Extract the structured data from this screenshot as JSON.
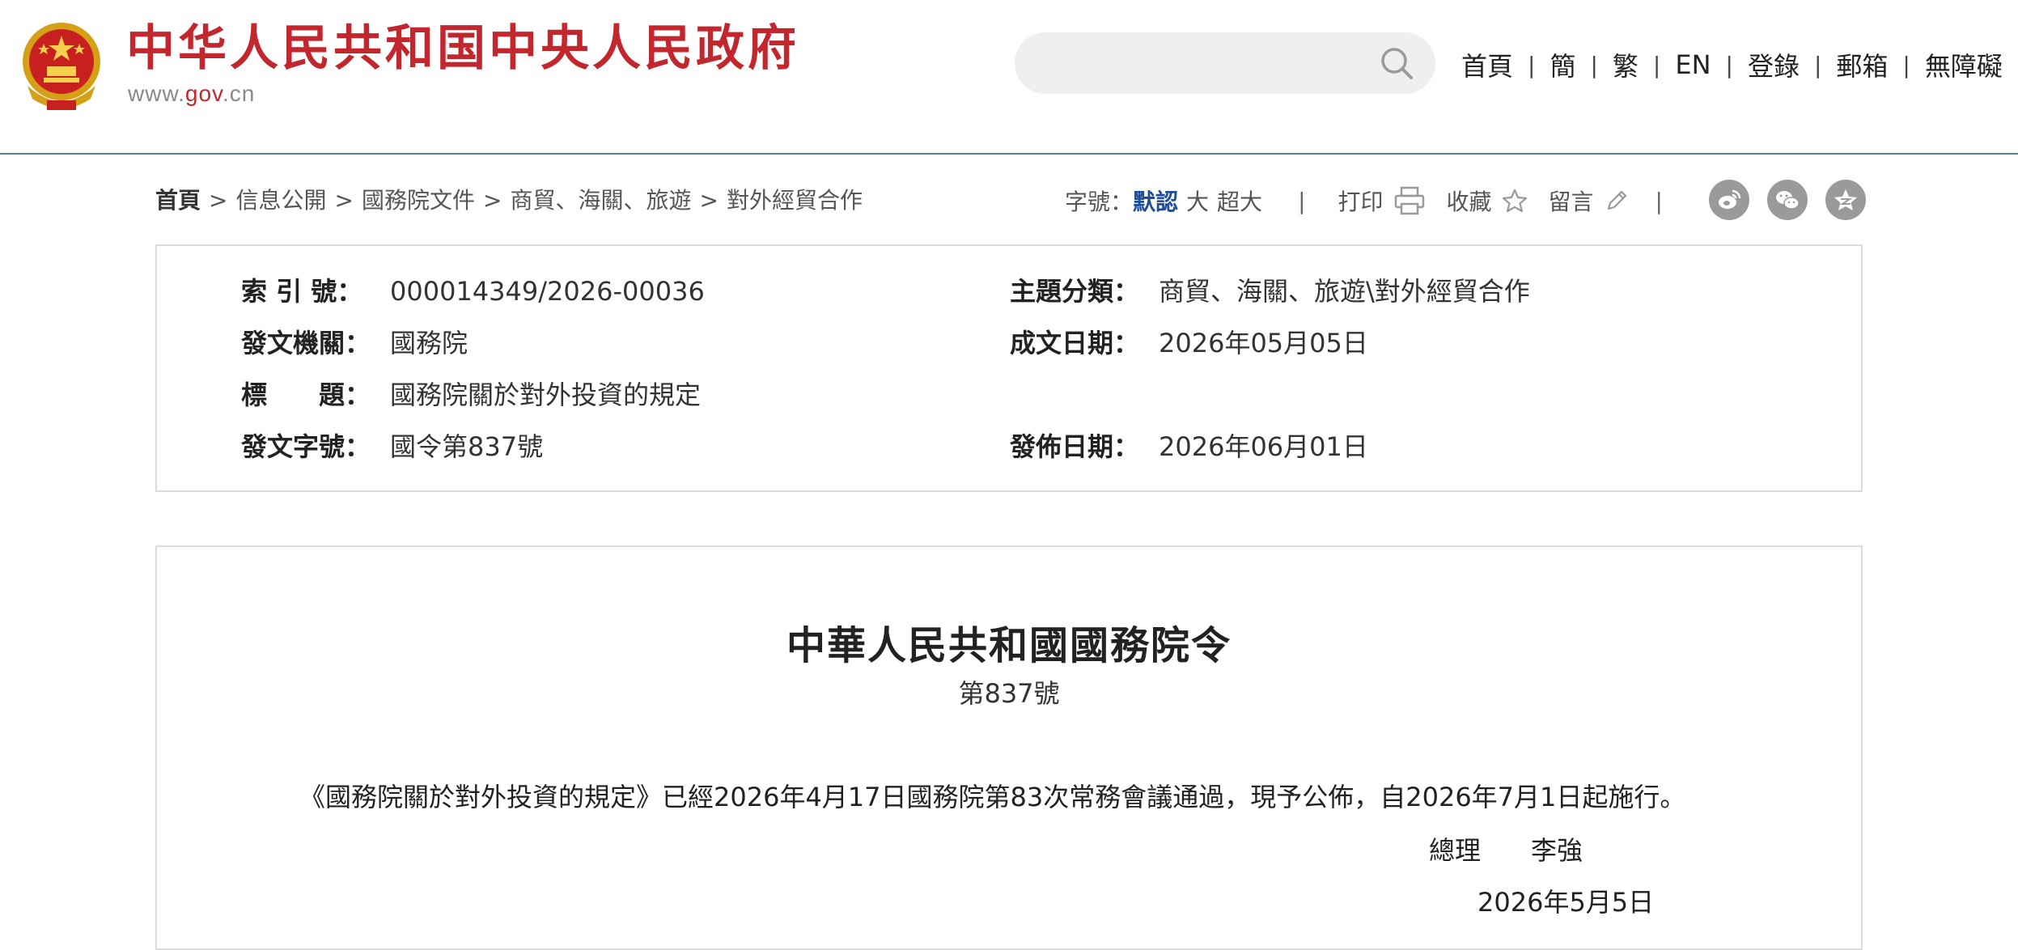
{
  "header": {
    "site_title": "中华人民共和国中央人民政府",
    "site_url_prefix": "www.",
    "site_url_domain": "gov",
    "site_url_suffix": ".cn",
    "search_placeholder": "",
    "nav": [
      "首頁",
      "簡",
      "繁",
      "EN",
      "登錄",
      "郵箱",
      "無障礙"
    ],
    "nav_separator": "|",
    "brand_color": "#c1272d"
  },
  "breadcrumb": {
    "items": [
      "首頁",
      "信息公開",
      "國務院文件",
      "商貿、海關、旅遊",
      "對外經貿合作"
    ],
    "separator": ">"
  },
  "tools": {
    "font_size_label": "字號：",
    "font_sizes": [
      "默認",
      "大",
      "超大"
    ],
    "active_font_size": "默認",
    "divider": "|",
    "print_label": "打印",
    "favorite_label": "收藏",
    "message_label": "留言",
    "social_icons": [
      "weibo-icon",
      "wechat-icon",
      "qzone-icon"
    ]
  },
  "meta": {
    "index_no_label": "索 引 號：",
    "index_no": "000014349/2026-00036",
    "issuer_label": "發文機關：",
    "issuer": "國務院",
    "title_label": "標　　題：",
    "title": "國務院關於對外投資的規定",
    "doc_no_label": "發文字號：",
    "doc_no": "國令第837號",
    "category_label": "主題分類：",
    "category": "商貿、海關、旅遊\\對外經貿合作",
    "written_date_label": "成文日期：",
    "written_date": "2026年05月05日",
    "publish_date_label": "發佈日期：",
    "publish_date": "2026年06月01日"
  },
  "document": {
    "heading": "中華人民共和國國務院令",
    "number": "第837號",
    "body": "《國務院關於對外投資的規定》已經2026年4月17日國務院第83次常務會議通過，現予公佈，自2026年7月1日起施行。",
    "signer_title": "總理",
    "signer_name": "李強",
    "sign_date": "2026年5月5日"
  }
}
